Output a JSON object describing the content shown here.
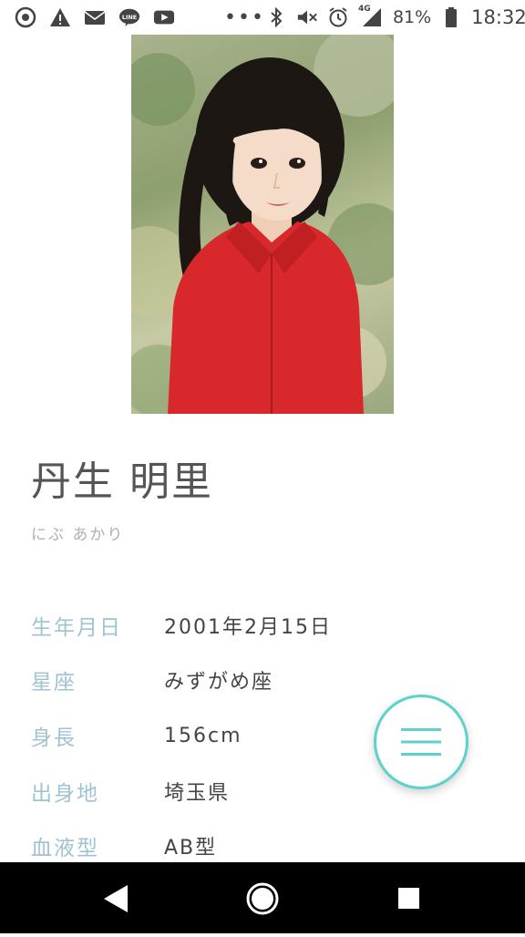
{
  "status_bar": {
    "battery": "81%",
    "time": "18:32",
    "network": "4G",
    "more": "•••",
    "app_icons": [
      "chrome-icon",
      "warning-icon",
      "mail-icon",
      "line-icon",
      "youtube-icon"
    ],
    "system_icons": [
      "bluetooth-icon",
      "mute-icon",
      "alarm-icon",
      "signal-icon",
      "battery-icon"
    ]
  },
  "profile": {
    "name": "丹生 明里",
    "kana": "にぶ あかり"
  },
  "info": [
    {
      "label": "生年月日",
      "value": "2001年2月15日"
    },
    {
      "label": "星座",
      "value": "みずがめ座"
    },
    {
      "label": "身長",
      "value": "156cm"
    },
    {
      "label": "出身地",
      "value": "埼玉県"
    },
    {
      "label": "血液型",
      "value": "AB型"
    }
  ],
  "colors": {
    "label": "#9fc3d3",
    "value": "#444444",
    "name": "#555555",
    "kana": "#b0b0b0",
    "menu_accent": "#5fd1cc"
  },
  "nav_icons": [
    "back-icon",
    "home-icon",
    "recents-icon"
  ],
  "menu_icon": "hamburger-menu-icon"
}
